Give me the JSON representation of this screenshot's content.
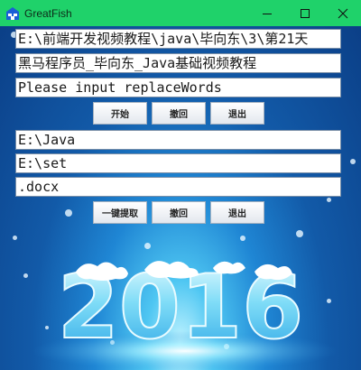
{
  "window": {
    "title": "GreatFish"
  },
  "fields": {
    "source_path": "E:\\前端开发视频教程\\java\\毕向东\\3\\第21天",
    "find_text": "黑马程序员_毕向东_Java基础视频教程",
    "replace_placeholder": "Please input replaceWords",
    "base_dir": "E:\\Java",
    "output_dir": "E:\\set",
    "extension": ".docx"
  },
  "buttons": {
    "start": "开始",
    "undo": "撤回",
    "exit": "退出",
    "extract": "一键提取",
    "undo2": "撤回",
    "exit2": "退出"
  },
  "background": {
    "art_text": "2016"
  },
  "colors": {
    "titlebar": "#1fd26a",
    "background_deep": "#0b3f87",
    "background_light": "#4ec6f2"
  }
}
